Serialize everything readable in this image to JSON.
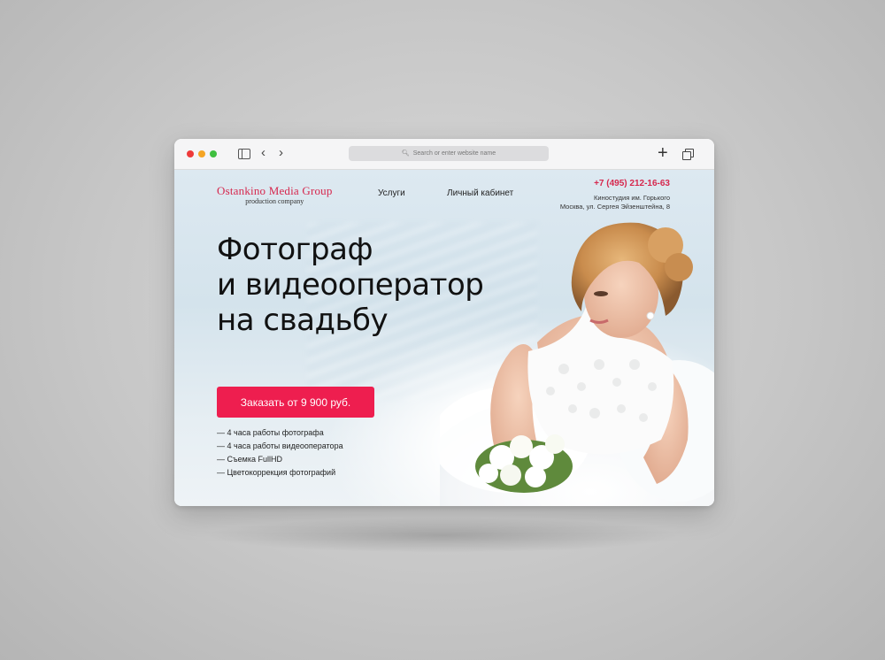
{
  "browser": {
    "address_placeholder": "Search or enter website name"
  },
  "site": {
    "logo_main": "Ostankino Media Group",
    "logo_sub": "production company",
    "nav": [
      "Услуги",
      "Личный кабинет"
    ],
    "phone": "+7 (495) 212-16-63",
    "address_line1": "Киностудия им. Горького",
    "address_line2": "Москва, ул. Сергея Эйзенштейна, 8"
  },
  "hero": {
    "headline_lines": [
      "Фотограф",
      "и видеооператор",
      "на свадьбу"
    ],
    "cta_label": "Заказать от 9 900 руб.",
    "features": [
      "— 4 часа работы фотографа",
      "— 4 часа работы видеооператора",
      "— Съемка FullHD",
      "— Цветокоррекция фотографий"
    ]
  },
  "colors": {
    "accent": "#ee1e4f",
    "brand_red": "#d6274d",
    "background_gray": "#c7c7c7"
  },
  "icons": [
    "sidebar-icon",
    "back-arrow-icon",
    "forward-arrow-icon",
    "search-icon",
    "plus-icon",
    "tabs-icon"
  ]
}
